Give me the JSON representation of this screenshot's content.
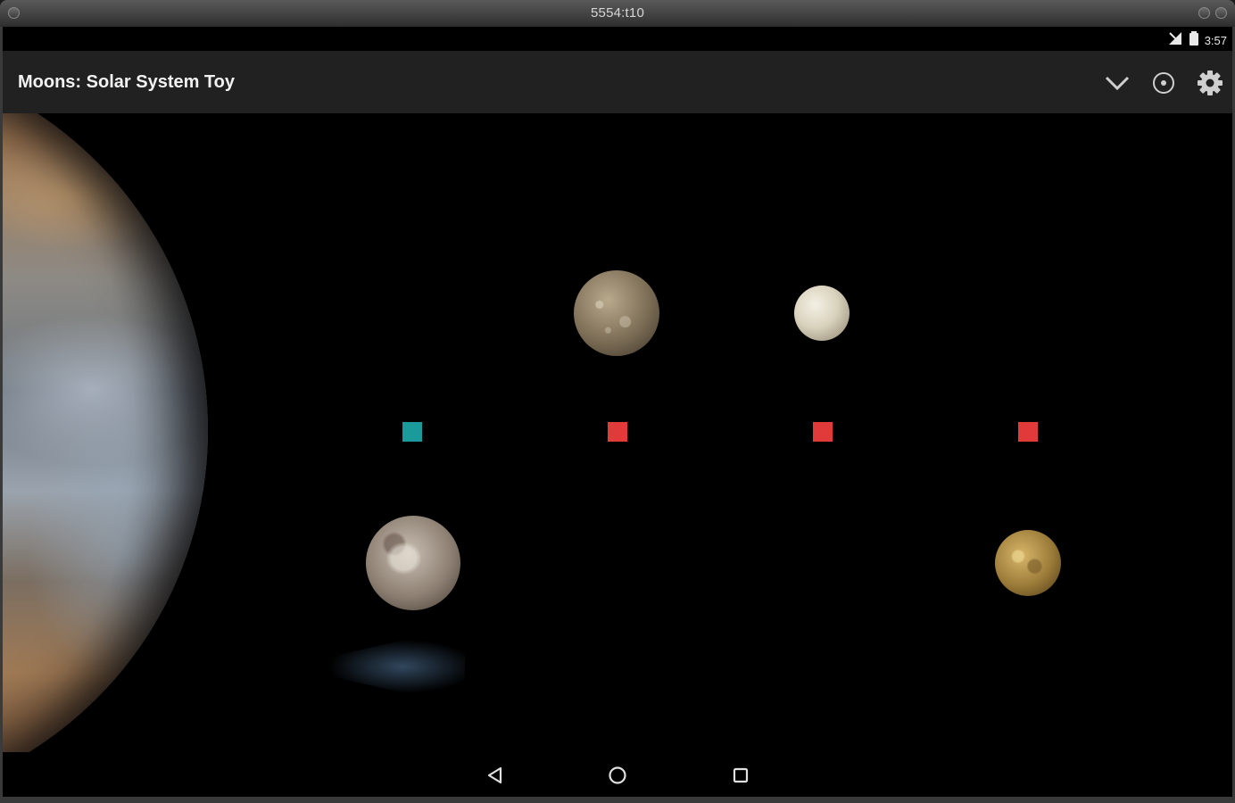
{
  "window": {
    "title": "5554:t10"
  },
  "status_bar": {
    "time": "3:57",
    "icons": [
      "signal-icon",
      "battery-icon"
    ]
  },
  "action_bar": {
    "title": "Moons: Solar System Toy",
    "actions": [
      "chevron-down-icon",
      "target-icon",
      "gear-icon"
    ]
  },
  "scene": {
    "planet": "jupiter",
    "moons": [
      "callisto",
      "europa",
      "ganymede",
      "io"
    ],
    "markers": [
      {
        "color": "#1a9a9a"
      },
      {
        "color": "#e03a3a"
      },
      {
        "color": "#e03a3a"
      },
      {
        "color": "#e03a3a"
      }
    ]
  },
  "nav_bar": {
    "buttons": [
      "back-icon",
      "home-icon",
      "recents-icon"
    ]
  }
}
